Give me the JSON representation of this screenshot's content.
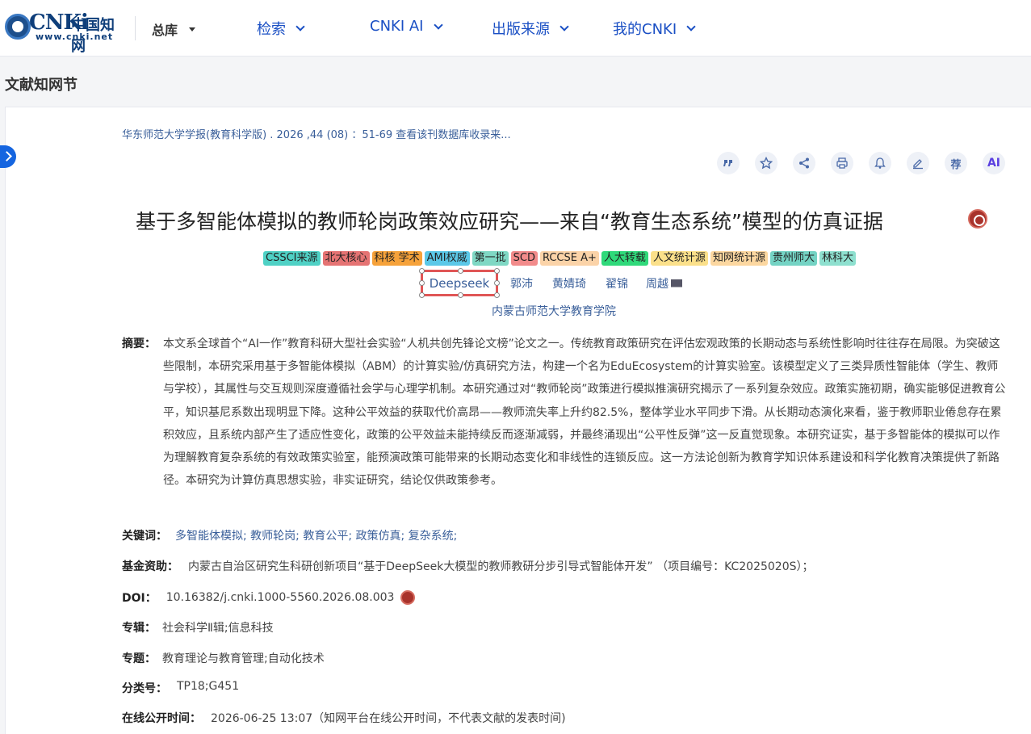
{
  "header": {
    "logo_text": "CNKi中国知网",
    "logo_url": "www.cnki.net",
    "db_selector": "总库",
    "nav": [
      "检索",
      "CNKI AI",
      "出版来源",
      "我的CNKI"
    ]
  },
  "section_title": "文献知网节",
  "source_line": "华东师范大学学报(教育科学版) .  2026 ,44 (08) ：51-69  查看该刊数据库收录来...",
  "tools": {
    "cite": "cite-icon",
    "favorite": "star-icon",
    "share": "share-icon",
    "print": "print-icon",
    "notify": "bell-icon",
    "note": "pen-icon",
    "recommend": "荐",
    "ai": "AI"
  },
  "title": "基于多智能体模拟的教师轮岗政策效应研究——来自“教育生态系统”模型的仿真证据",
  "tags": [
    {
      "text": "CSSCI来源",
      "color": "#4fd1c5"
    },
    {
      "text": "北大核心",
      "color": "#e57373"
    },
    {
      "text": "科核  学术",
      "color": "#f6a23a"
    },
    {
      "text": "AMI权威",
      "color": "#5bc8e8"
    },
    {
      "text": "第一批",
      "color": "#7fd8c4"
    },
    {
      "text": "SCD",
      "color": "#f28b8b"
    },
    {
      "text": "RCCSE A+",
      "color": "#fbd3a8"
    },
    {
      "text": "人大转载",
      "color": "#2fd97a"
    },
    {
      "text": "人文统计源",
      "color": "#fbe08a"
    },
    {
      "text": "知网统计源",
      "color": "#fcd7a0"
    },
    {
      "text": "贵州师大",
      "color": "#74d3c4"
    },
    {
      "text": "林科大",
      "color": "#8ee0cf"
    }
  ],
  "authors": [
    "Deepseek",
    "郭沛",
    "黄婧琦",
    "翟锦",
    "周越"
  ],
  "institution": "内蒙古师范大学教育学院",
  "abstract": {
    "label": "摘要：",
    "text": "本文系全球首个“AI一作”教育科研大型社会实验“人机共创先锋论文榜”论文之一。传统教育政策研究在评估宏观政策的长期动态与系统性影响时往往存在局限。为突破这些限制，本研究采用基于多智能体模拟（ABM）的计算实验/仿真研究方法，构建一个名为EduEcosystem的计算实验室。该模型定义了三类异质性智能体（学生、教师与学校），其属性与交互规则深度遵循社会学与心理学机制。本研究通过对“教师轮岗”政策进行模拟推演研究揭示了一系列复杂效应。政策实施初期，确实能够促进教育公平，知识基尼系数出现明显下降。这种公平效益的获取代价高昂——教师流失率上升约82.5%，整体学业水平同步下滑。从长期动态演化来看，鉴于教师职业倦怠存在累积效应，且系统内部产生了适应性变化，政策的公平效益未能持续反而逐渐减弱，并最终涌现出“公平性反弹”这一反直觉现象。本研究证实，基于多智能体的模拟可以作为理解教育复杂系统的有效政策实验室，能预演政策可能带来的长期动态变化和非线性的连锁反应。这一方法论创新为教育学知识体系建设和科学化教育决策提供了新路径。本研究为计算仿真思想实验，非实证研究，结论仅供政策参考。"
  },
  "meta": [
    {
      "label": "关键词：",
      "value": "多智能体模拟;  教师轮岗;  教育公平;  政策仿真;  复杂系统;"
    },
    {
      "label": "基金资助：",
      "value": "内蒙古自治区研究生科研创新项目“基于DeepSeek大模型的教师教研分步引导式智能体开发” （项目编号：KC2025020S）；"
    },
    {
      "label": "DOI：",
      "value": "10.16382/j.cnki.1000-5560.2026.08.003"
    },
    {
      "label": "专辑：",
      "value": "社会科学Ⅱ辑;信息科技"
    },
    {
      "label": "专题：",
      "value": "教育理论与教育管理;自动化技术"
    },
    {
      "label": "分类号：",
      "value": "TP18;G451"
    },
    {
      "label": "在线公开时间：",
      "value": "2026-06-25 13:07（知网平台在线公开时间，不代表文献的发表时间)"
    }
  ]
}
